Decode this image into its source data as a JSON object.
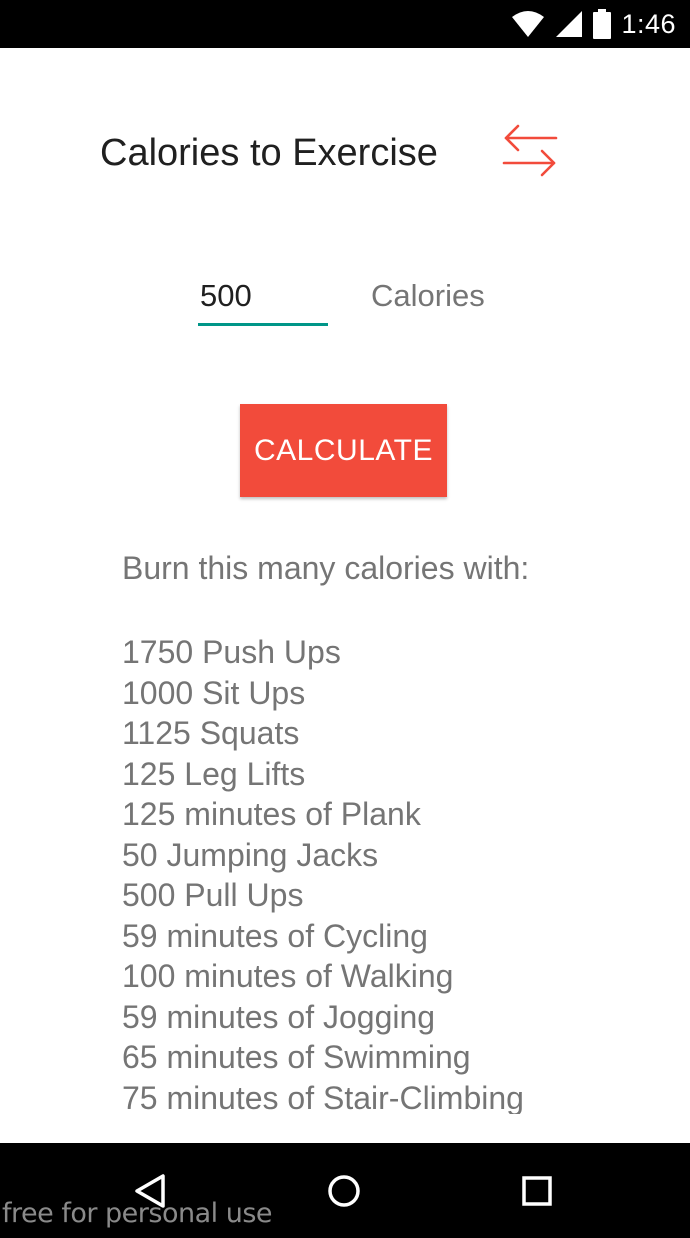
{
  "status_bar": {
    "time": "1:46",
    "icons": [
      "wifi-icon",
      "signal-icon",
      "battery-icon"
    ]
  },
  "header": {
    "title": "Calories to Exercise",
    "swap_icon": "swap-arrows-icon"
  },
  "input": {
    "value": "500",
    "unit": "Calories"
  },
  "calculate_label": "CALCULATE",
  "results": {
    "heading": "Burn this many calories with:",
    "items": [
      "1750 Push Ups",
      "1000 Sit Ups",
      "1125 Squats",
      "125 Leg Lifts",
      "125 minutes of Plank",
      "50 Jumping Jacks",
      "500 Pull Ups",
      "59 minutes of Cycling",
      "100 minutes of Walking",
      "59 minutes of Jogging",
      "65 minutes of Swimming",
      "75 minutes of Stair-Climbing"
    ]
  },
  "nav_bar": {
    "icons": [
      "back-icon",
      "home-icon",
      "recents-icon"
    ]
  },
  "watermark": "free for personal use",
  "colors": {
    "accent": "#f24b3b",
    "input_underline": "#009688",
    "text_secondary": "#757575",
    "text_primary": "#202020"
  }
}
